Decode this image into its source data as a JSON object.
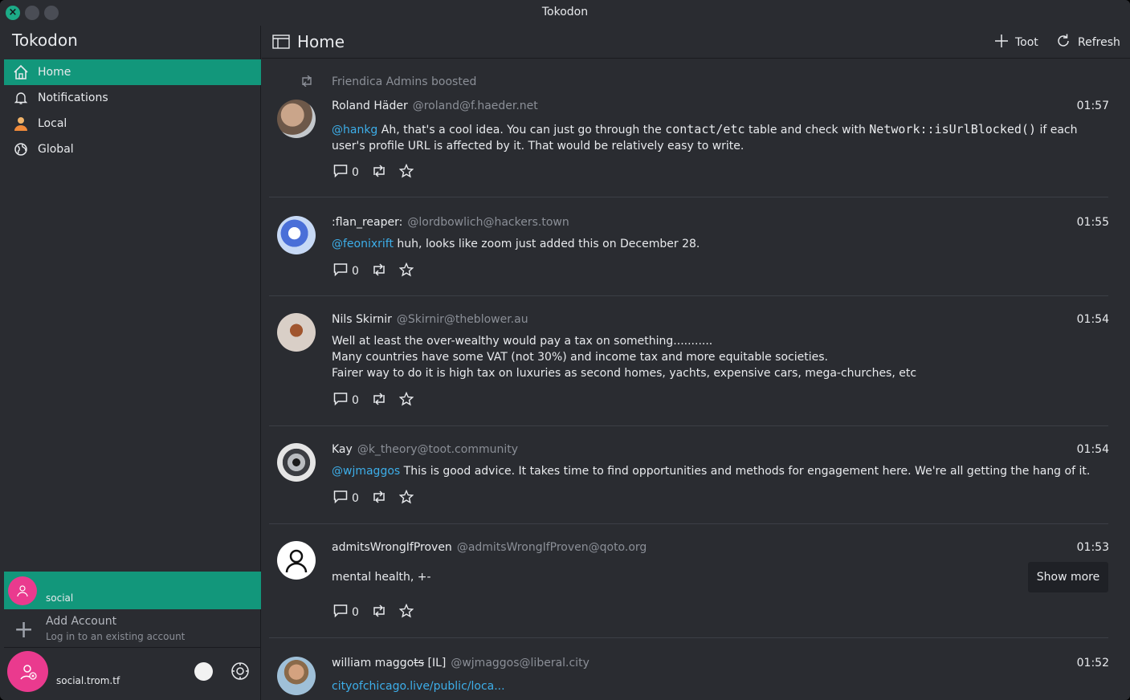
{
  "window": {
    "title": "Tokodon"
  },
  "sidebar": {
    "app_name": "Tokodon",
    "items": [
      {
        "label": "Home",
        "icon": "home-icon",
        "active": true
      },
      {
        "label": "Notifications",
        "icon": "bell-icon",
        "active": false
      },
      {
        "label": "Local",
        "icon": "users-icon",
        "active": false
      },
      {
        "label": "Global",
        "icon": "globe-icon",
        "active": false
      }
    ],
    "active_account": {
      "label": "social"
    },
    "add_account": {
      "title": "Add Account",
      "subtitle": "Log in to an existing account"
    },
    "footer": {
      "label": "social.trom.tf"
    }
  },
  "header": {
    "title": "Home",
    "toot_label": "Toot",
    "refresh_label": "Refresh"
  },
  "posts": [
    {
      "boosted_by": "Friendica Admins boosted",
      "display_name": "Roland Häder",
      "handle": "@roland@f.haeder.net",
      "time": "01:57",
      "mention": "@hankg",
      "text_a": " Ah, that's a cool idea. You can just go through the ",
      "code_a": "contact/etc",
      "text_b": " table and check with ",
      "code_b": "Network::isUrlBlocked()",
      "text_c": " if each user's profile URL is affected by it. That would be relatively easy to write.",
      "replies": "0"
    },
    {
      "display_name": ":flan_reaper:",
      "handle": "@lordbowlich@hackers.town",
      "time": "01:55",
      "mention": "@feonixrift",
      "text": " huh, looks like zoom just added this on December 28.",
      "replies": "0"
    },
    {
      "display_name": "Nils Skirnir",
      "handle": "@Skirnir@theblower.au",
      "time": "01:54",
      "lines": [
        "Well at least the over-wealthy would pay a tax on something...........",
        "Many countries have some VAT (not 30%) and income tax and more equitable societies.",
        "Fairer way to do it is high tax on luxuries as second homes, yachts, expensive cars, mega-churches, etc"
      ],
      "replies": "0"
    },
    {
      "display_name": "Kay",
      "handle": "@k_theory@toot.community",
      "time": "01:54",
      "mention": "@wjmaggos",
      "text": " This is good advice. It takes time to find opportunities and methods for engagement here. We're all getting the hang of it.",
      "replies": "0"
    },
    {
      "display_name": "admitsWrongIfProven",
      "handle": "@admitsWrongIfProven@qoto.org",
      "time": "01:53",
      "spoiler": "mental health, +-",
      "show_more": "Show more",
      "replies": "0"
    },
    {
      "display_name_a": "william maggo",
      "display_name_strike": "ts",
      "display_name_b": " [IL]",
      "handle": "@wjmaggos@liberal.city",
      "time": "01:52",
      "link": "cityofchicago.live/public/loca..."
    }
  ],
  "colors": {
    "accent": "#12977b",
    "link": "#3daee9",
    "avatar_pink": "#ea3a8e"
  }
}
